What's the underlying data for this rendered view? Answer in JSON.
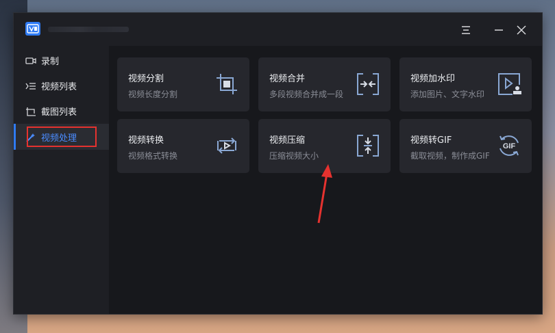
{
  "window": {
    "title": ""
  },
  "sidebar": {
    "items": [
      {
        "label": "录制",
        "icon": "camera-icon",
        "active": false
      },
      {
        "label": "视频列表",
        "icon": "video-list-icon",
        "active": false
      },
      {
        "label": "截图列表",
        "icon": "screenshot-list-icon",
        "active": false
      },
      {
        "label": "视频处理",
        "icon": "magic-wand-icon",
        "active": true
      }
    ]
  },
  "tools": [
    {
      "title": "视频分割",
      "desc": "视频长度分割",
      "icon": "crop-icon"
    },
    {
      "title": "视频合并",
      "desc": "多段视频合并成一段",
      "icon": "merge-icon"
    },
    {
      "title": "视频加水印",
      "desc": "添加图片、文字水印",
      "icon": "watermark-icon"
    },
    {
      "title": "视频转换",
      "desc": "视频格式转换",
      "icon": "convert-icon"
    },
    {
      "title": "视频压缩",
      "desc": "压缩视频大小",
      "icon": "compress-icon"
    },
    {
      "title": "视频转GIF",
      "desc": "截取视频，制作成GIF",
      "icon": "gif-icon"
    }
  ],
  "colors": {
    "accent": "#2f7bf5",
    "active_label": "#4b8cff",
    "annotation_red": "#e6322f",
    "icon_stroke": "#8aa8d4"
  }
}
